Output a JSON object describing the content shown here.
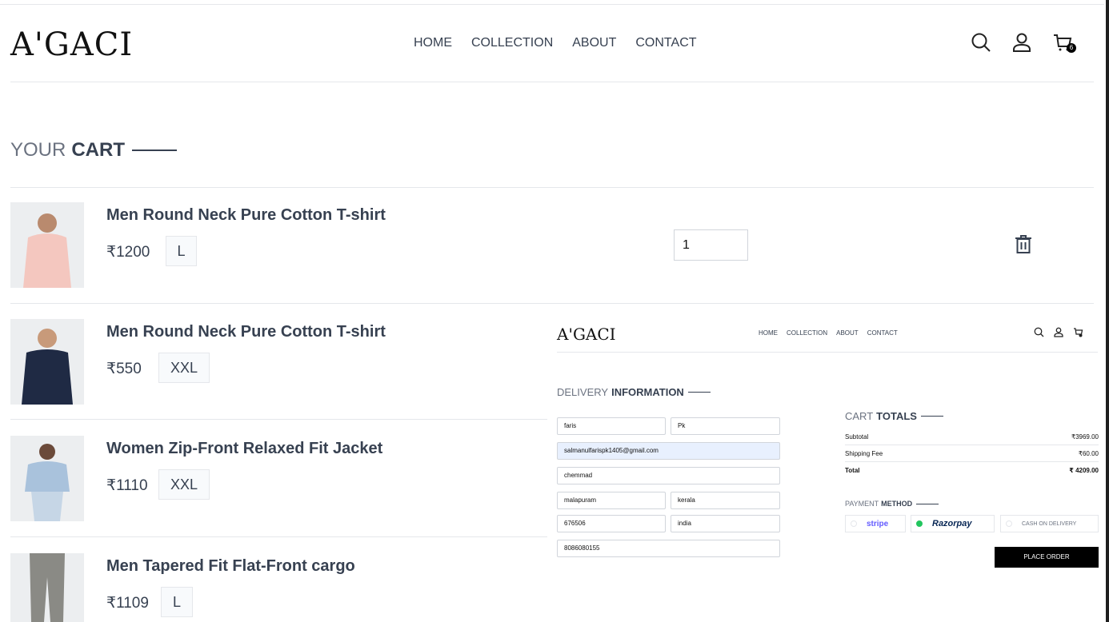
{
  "brand": {
    "logo": "A'GACI"
  },
  "nav": {
    "items": [
      "HOME",
      "COLLECTION",
      "ABOUT",
      "CONTACT"
    ],
    "cart_count": "6"
  },
  "cart": {
    "title_light": "YOUR",
    "title_bold": "CART",
    "items": [
      {
        "name": "Men Round Neck Pure Cotton T-shirt",
        "price": "₹1200",
        "size": "L",
        "quantity": "1",
        "thumb_color": "#f4c7bf"
      },
      {
        "name": "Men Round Neck Pure Cotton T-shirt",
        "price": "₹550",
        "size": "XXL",
        "thumb_color": "#1f2a44"
      },
      {
        "name": "Women Zip-Front Relaxed Fit Jacket",
        "price": "₹1110",
        "size": "XXL",
        "thumb_color": "#a9c2dc"
      },
      {
        "name": "Men Tapered Fit Flat-Front cargo",
        "price": "₹1109",
        "size": "L",
        "thumb_color": "#8a8a85"
      }
    ]
  },
  "checkout": {
    "logo": "A'GACI",
    "nav": [
      "HOME",
      "COLLECTION",
      "ABOUT",
      "CONTACT"
    ],
    "delivery_title_light": "DELIVERY",
    "delivery_title_bold": "INFORMATION",
    "fields": {
      "first_name": "faris",
      "last_name": "Pk",
      "email": "salmanulfarispk1405@gmail.com",
      "street": "chemmad",
      "city": "malapuram",
      "state": "kerala",
      "zipcode": "676506",
      "country": "india",
      "phone": "8086080155"
    },
    "totals_title_light": "CART",
    "totals_title_bold": "TOTALS",
    "subtotal_label": "Subtotal",
    "subtotal_value": "₹3969.00",
    "shipping_label": "Shipping Fee",
    "shipping_value": "₹60.00",
    "total_label": "Total",
    "total_value": "₹ 4209.00",
    "payment_title_light": "PAYMENT",
    "payment_title_bold": "METHOD",
    "payment_options": {
      "stripe": "stripe",
      "razorpay": "Razorpay",
      "cod": "CASH ON DELIVERY"
    },
    "selected_payment": "razorpay",
    "place_order": "PLACE ORDER"
  }
}
